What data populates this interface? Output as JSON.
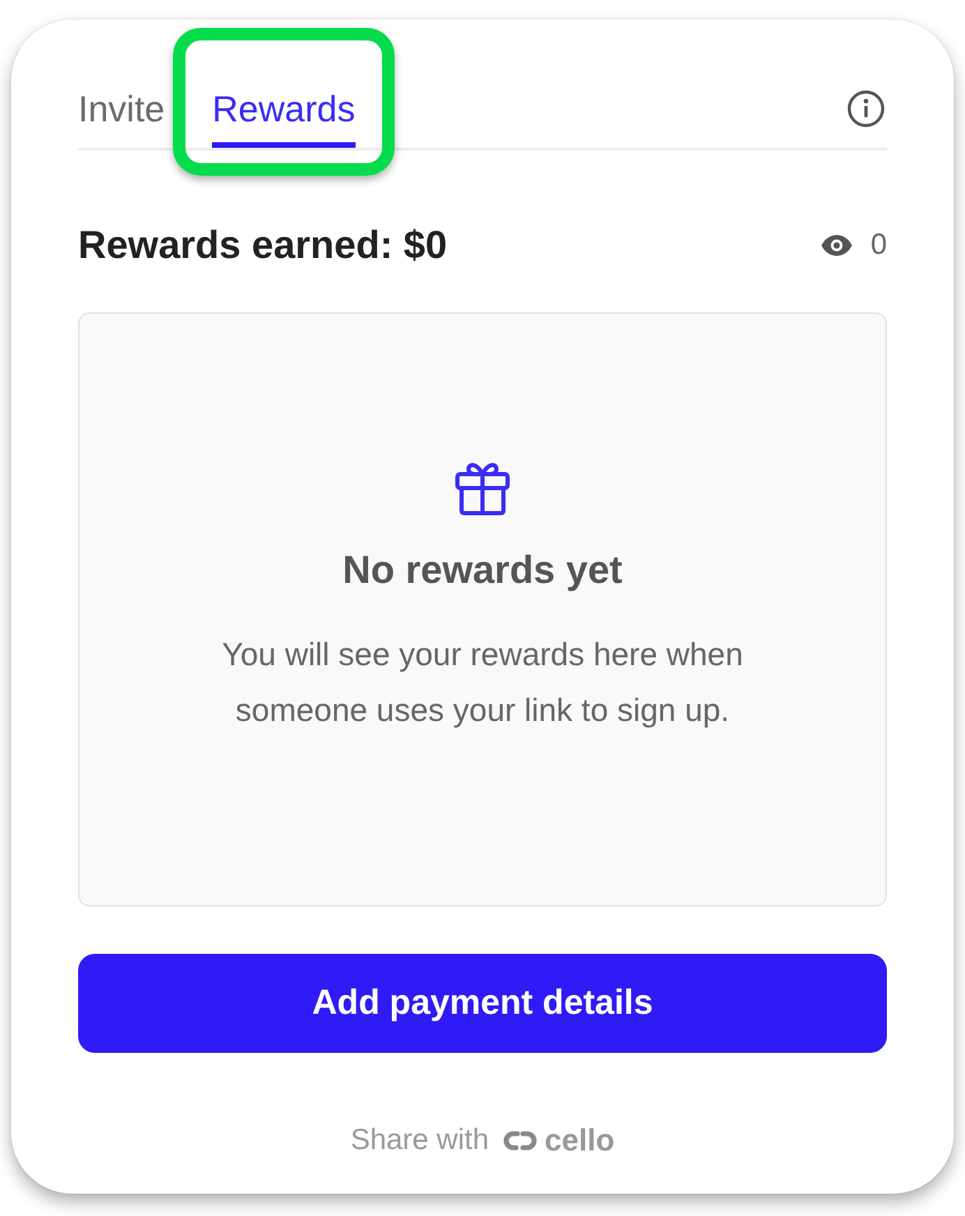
{
  "tabs": [
    {
      "label": "Invite",
      "selected": false,
      "highlighted": false
    },
    {
      "label": "Rewards",
      "selected": true,
      "highlighted": true
    }
  ],
  "summary": {
    "title": "Rewards earned: $0",
    "views": "0"
  },
  "empty_state": {
    "title": "No rewards yet",
    "message": "You will see your rewards here when someone uses your link to sign up."
  },
  "button": "Add payment details",
  "footer": {
    "prefix": "Share with",
    "brand": "cello"
  }
}
